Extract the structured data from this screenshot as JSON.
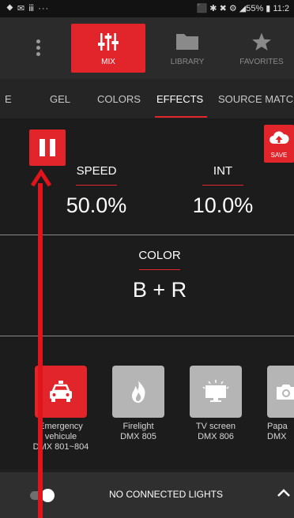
{
  "status_bar": {
    "left": "⯁ ✉ ⅲ ···",
    "right": "⬛ ✱ ✖ ⚙ ◢55% ▮ 11:2"
  },
  "top_tabs": [
    {
      "label": "MIX",
      "icon": "sliders-icon"
    },
    {
      "label": "LIBRARY",
      "icon": "folder-icon"
    },
    {
      "label": "FAVORITES",
      "icon": "star-icon"
    }
  ],
  "sub_tabs": [
    {
      "label": "E"
    },
    {
      "label": "GEL"
    },
    {
      "label": "COLORS"
    },
    {
      "label": "EFFECTS",
      "active": true
    },
    {
      "label": "SOURCE MATCH"
    }
  ],
  "effects": {
    "save_label": "SAVE",
    "speed": {
      "label": "SPEED",
      "value": "50.0%"
    },
    "intensity": {
      "label": "INT",
      "value": "10.0%"
    },
    "color": {
      "label": "COLOR",
      "value": "B + R"
    }
  },
  "presets": [
    {
      "name": "Emergency vehicule",
      "dmx": "DMX 801~804",
      "icon": "car-icon",
      "selected": true
    },
    {
      "name": "Firelight",
      "dmx": "DMX 805",
      "icon": "fire-icon"
    },
    {
      "name": "TV screen",
      "dmx": "DMX 806",
      "icon": "tv-icon"
    },
    {
      "name": "Papa",
      "dmx": "DMX",
      "icon": "camera-icon"
    }
  ],
  "bottom_bar": {
    "status": "NO CONNECTED LIGHTS",
    "toggle_on": true
  },
  "colors": {
    "accent": "#e1252b",
    "background": "#1c1c1c",
    "preset_bg": "#b5b5b5"
  }
}
